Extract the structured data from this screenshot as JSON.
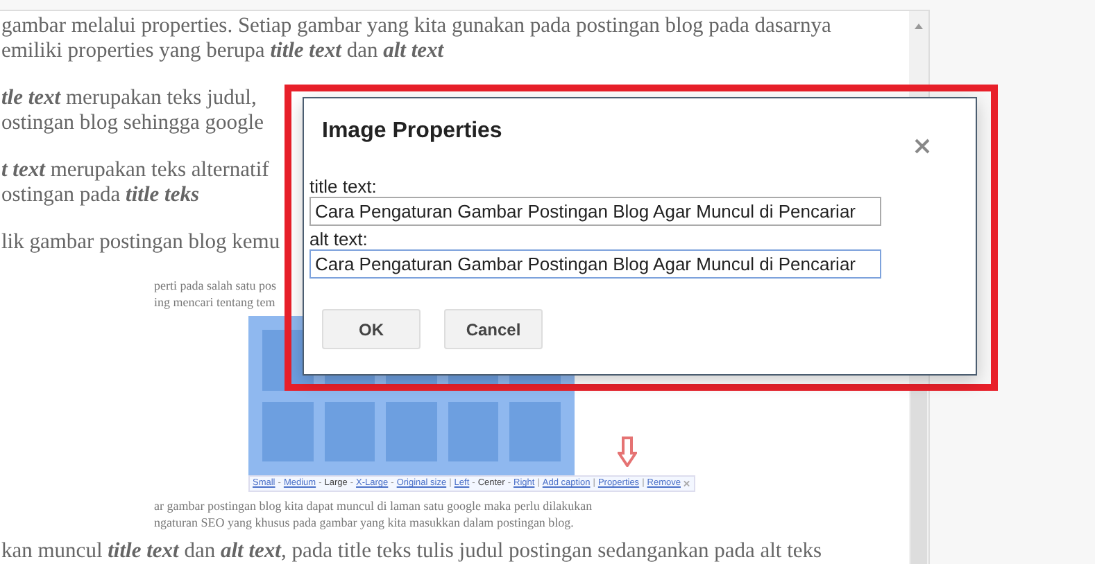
{
  "editor": {
    "paragraphs": [
      [
        "gambar melalui properties. Setiap gambar yang kita gunakan pada postingan blog pada dasarnya",
        "emiliki properties yang berupa **title text** dan **alt text**"
      ],
      [
        "**tle text** merupakan teks judul,",
        "ostingan blog sehingga google"
      ],
      [
        "**t text** merupakan teks alternatif",
        "ostingan pada **title teks**"
      ],
      [
        "lik gambar postingan blog kemu"
      ]
    ],
    "figure": {
      "caption_above": [
        "perti pada salah satu pos",
        "ing mencari tentang tem"
      ],
      "toolbar": [
        {
          "kind": "link",
          "label": "Small",
          "selected": false
        },
        {
          "kind": "separator",
          "label": "-"
        },
        {
          "kind": "link",
          "label": "Medium",
          "selected": false
        },
        {
          "kind": "separator",
          "label": "-"
        },
        {
          "kind": "link",
          "label": "Large",
          "selected": true
        },
        {
          "kind": "separator",
          "label": "-"
        },
        {
          "kind": "link",
          "label": "X-Large",
          "selected": false
        },
        {
          "kind": "separator",
          "label": "-"
        },
        {
          "kind": "link",
          "label": "Original size",
          "selected": false
        },
        {
          "kind": "separator",
          "label": "|"
        },
        {
          "kind": "link",
          "label": "Left",
          "selected": false
        },
        {
          "kind": "separator",
          "label": "-"
        },
        {
          "kind": "link",
          "label": "Center",
          "selected": true
        },
        {
          "kind": "separator",
          "label": "-"
        },
        {
          "kind": "link",
          "label": "Right",
          "selected": false
        },
        {
          "kind": "separator",
          "label": "|"
        },
        {
          "kind": "link",
          "label": "Add caption",
          "selected": false
        },
        {
          "kind": "separator",
          "label": "|"
        },
        {
          "kind": "link",
          "label": "Properties",
          "selected": false
        },
        {
          "kind": "separator",
          "label": "|"
        },
        {
          "kind": "link",
          "label": "Remove",
          "selected": false
        }
      ],
      "caption_below": [
        "ar gambar postingan blog kita dapat muncul di laman satu google maka perlu dilakukan",
        "ngaturan SEO yang khusus pada gambar yang kita masukkan dalam postingan blog."
      ]
    },
    "last_line": "kan muncul **title text** dan **alt text**, pada title teks tulis judul postingan sedangankan pada alt teks"
  },
  "dialog": {
    "title": "Image Properties",
    "fields": [
      {
        "label": "title text:",
        "value": "Cara Pengaturan Gambar Postingan Blog Agar Muncul di Pencariar",
        "focused": false
      },
      {
        "label": "alt text:",
        "value": "Cara Pengaturan Gambar Postingan Blog Agar Muncul di Pencariar",
        "focused": true
      }
    ],
    "buttons": [
      "OK",
      "Cancel"
    ]
  }
}
